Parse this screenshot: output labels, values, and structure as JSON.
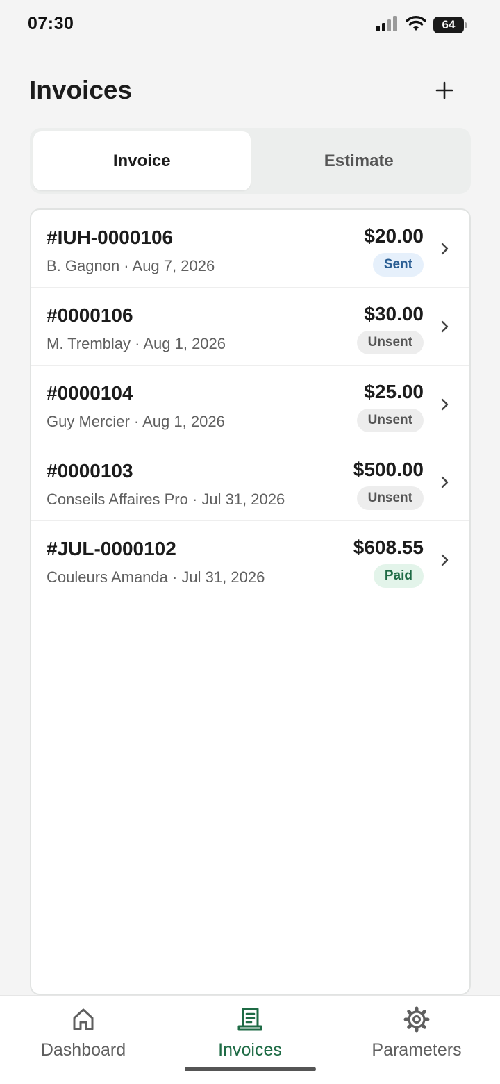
{
  "status": {
    "time": "07:30",
    "battery": "64"
  },
  "header": {
    "title": "Invoices",
    "add_icon": "plus-icon"
  },
  "segments": {
    "invoice": "Invoice",
    "estimate": "Estimate",
    "selected": "Invoice"
  },
  "invoices": [
    {
      "number": "#IUH-0000106",
      "subtitle": "B. Gagnon · Aug 7, 2026",
      "amount": "$20.00",
      "status": "Sent"
    },
    {
      "number": "#0000106",
      "subtitle": "M. Tremblay · Aug 1, 2026",
      "amount": "$30.00",
      "status": "Unsent"
    },
    {
      "number": "#0000104",
      "subtitle": "Guy Mercier · Aug 1, 2026",
      "amount": "$25.00",
      "status": "Unsent"
    },
    {
      "number": "#0000103",
      "subtitle": "Conseils Affaires Pro · Jul 31, 2026",
      "amount": "$500.00",
      "status": "Unsent"
    },
    {
      "number": "#JUL-0000102",
      "subtitle": "Couleurs Amanda · Jul 31, 2026",
      "amount": "$608.55",
      "status": "Paid"
    }
  ],
  "nav": {
    "dashboard": "Dashboard",
    "invoices": "Invoices",
    "parameters": "Parameters",
    "active": "Invoices"
  },
  "colors": {
    "accent": "#1e6b45",
    "sent_bg": "#e6f0fb",
    "sent_text": "#2a5e93",
    "unsent_bg": "#ededed",
    "unsent_text": "#555555",
    "paid_bg": "#e3f4ea",
    "paid_text": "#1e6b45"
  }
}
